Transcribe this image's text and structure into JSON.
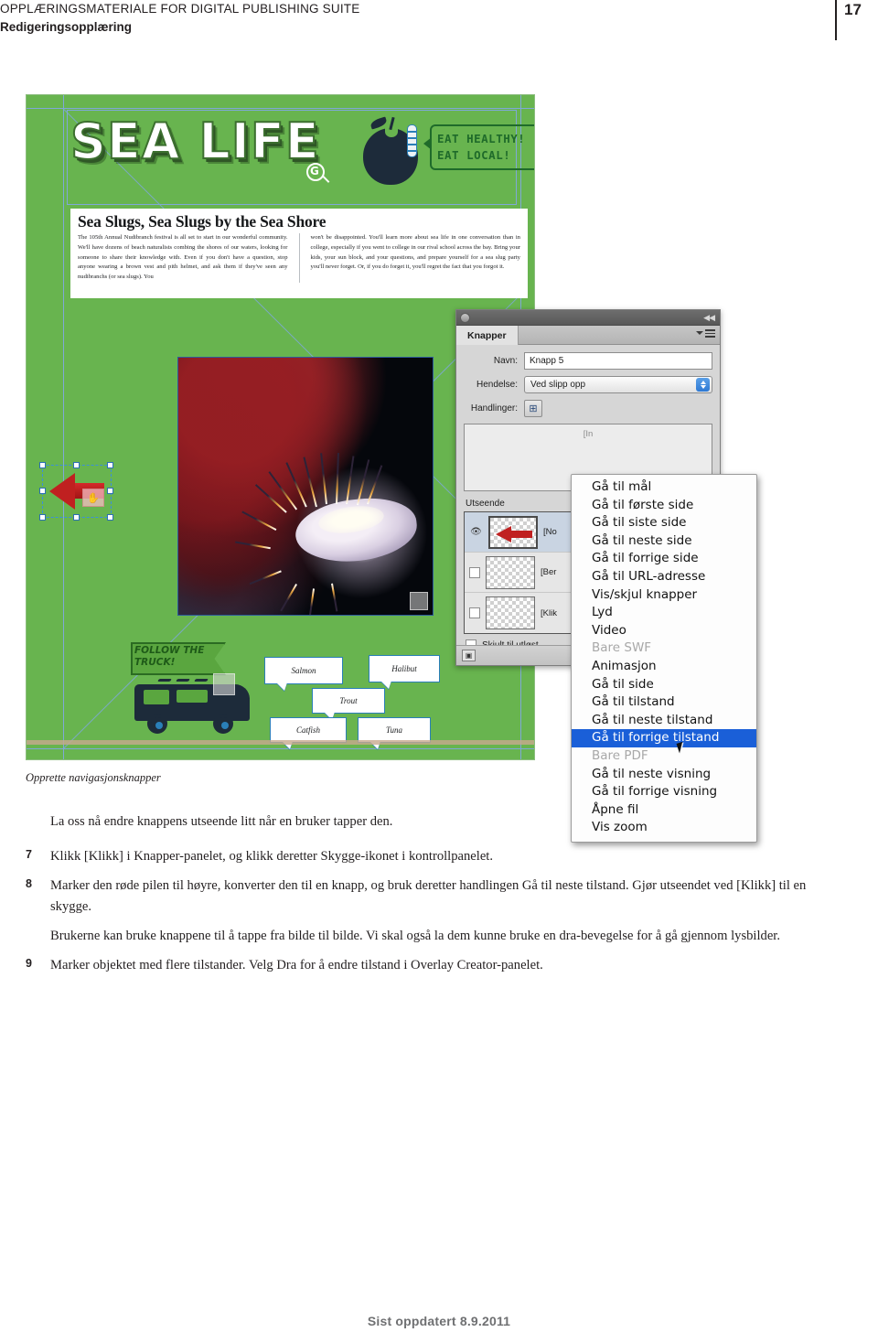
{
  "header": {
    "title": "OPPLÆRINGSMATERIALE FOR DIGITAL PUBLISHING SUITE",
    "subtitle": "Redigeringsopplæring",
    "page_number": "17"
  },
  "screenshot": {
    "document": {
      "masthead_title": "SEA LIFE",
      "magnifier_glyph": "G",
      "callout_text": "EAT HEALTHY!\nEAT LOCAL!",
      "article_title": "Sea Slugs, Sea Slugs by the Sea Shore",
      "article_col_left": "The 105th Annual Nudibranch festival is all set to start in our wonderful community. We'll have dozens of beach naturalists combing the shores of our waters, looking for someone to share their knowledge with. Even if you don't have a question, stop anyone wearing a brown vest and pith helmet, and ask them if they've seen any nudibranchs (or sea slugs). You",
      "article_col_right": "won't be disappointed. You'll learn more about sea life in one conversation than in college, especially if you went to college in our rival school across the bay. Bring your kids, your sun block, and your questions, and prepare yourself for a sea slug party you'll never forget. Or, if you do forget it, you'll regret the fact that you forgot it.",
      "follow_flag_text": "FOLLOW THE\nTRUCK!",
      "fish_buttons": [
        "Salmon",
        "Halibut",
        "Trout",
        "Catfish",
        "Tuna"
      ]
    },
    "panel": {
      "tab_label": "Knapper",
      "fields": [
        {
          "label": "Navn:",
          "value": "Knapp 5"
        },
        {
          "label": "Hendelse:",
          "value": "Ved slipp opp"
        },
        {
          "label": "Handlinger:",
          "value": ""
        }
      ],
      "actions_placeholder": "[In",
      "appearance_label": "Utseende",
      "states": [
        {
          "name": "[No",
          "visible": true
        },
        {
          "name": "[Ber",
          "visible": false
        },
        {
          "name": "[Klik",
          "visible": false
        }
      ],
      "hidden_until_triggered": "Skjult til utløst",
      "action_button_icon": "button-convert-icon"
    },
    "menu": {
      "items": [
        {
          "label": "Gå til mål",
          "type": "item"
        },
        {
          "label": "Gå til første side",
          "type": "item"
        },
        {
          "label": "Gå til siste side",
          "type": "item"
        },
        {
          "label": "Gå til neste side",
          "type": "item"
        },
        {
          "label": "Gå til forrige side",
          "type": "item"
        },
        {
          "label": "Gå til URL-adresse",
          "type": "item"
        },
        {
          "label": "Vis/skjul knapper",
          "type": "item"
        },
        {
          "label": "Lyd",
          "type": "item"
        },
        {
          "label": "Video",
          "type": "item"
        },
        {
          "label": "Bare SWF",
          "type": "header"
        },
        {
          "label": "Animasjon",
          "type": "item"
        },
        {
          "label": "Gå til side",
          "type": "item"
        },
        {
          "label": "Gå til tilstand",
          "type": "item"
        },
        {
          "label": "Gå til neste tilstand",
          "type": "item"
        },
        {
          "label": "Gå til forrige tilstand",
          "type": "selected"
        },
        {
          "label": "Bare PDF",
          "type": "header"
        },
        {
          "label": "Gå til neste visning",
          "type": "item"
        },
        {
          "label": "Gå til forrige visning",
          "type": "item"
        },
        {
          "label": "Åpne fil",
          "type": "item"
        },
        {
          "label": "Vis zoom",
          "type": "item"
        }
      ],
      "selection_color": "#1a5fd8"
    }
  },
  "caption": "Opprette navigasjonsknapper",
  "steps": [
    {
      "num": "",
      "text": "La oss nå endre knappens utseende litt når en bruker tapper den."
    },
    {
      "num": "7",
      "text": "Klikk [Klikk] i Knapper-panelet, og klikk deretter Skygge-ikonet i kontrollpanelet."
    },
    {
      "num": "8",
      "text": "Marker den røde pilen til høyre, konverter den til en knapp, og bruk deretter handlingen Gå til neste tilstand. Gjør utseendet ved [Klikk] til en skygge."
    },
    {
      "num": "",
      "text": "Brukerne kan bruke knappene til å tappe fra bilde til bilde. Vi skal også la dem kunne bruke en dra-bevegelse for å gå gjennom lysbilder."
    },
    {
      "num": "9",
      "text": "Marker objektet med flere tilstander. Velg Dra for å endre tilstand i Overlay Creator-panelet."
    }
  ],
  "footer": "Sist oppdatert 8.9.2011",
  "colors": {
    "document_green": "#68b44f",
    "selection_blue": "#1a5fd8",
    "arrow_red": "#c02020",
    "guide_blue": "#7fa8d8"
  }
}
